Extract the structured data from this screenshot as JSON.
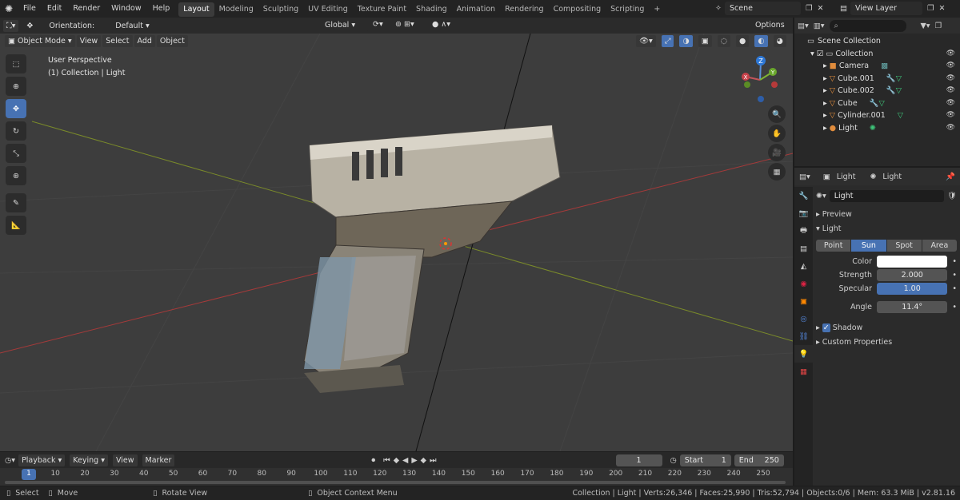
{
  "topbar": {
    "menus": [
      "File",
      "Edit",
      "Render",
      "Window",
      "Help"
    ],
    "workspaces": [
      "Layout",
      "Modeling",
      "Sculpting",
      "UV Editing",
      "Texture Paint",
      "Shading",
      "Animation",
      "Rendering",
      "Compositing",
      "Scripting"
    ],
    "active_workspace": "Layout",
    "add_tab": "+",
    "scene": "Scene",
    "view_layer": "View Layer"
  },
  "viewport_header": {
    "orientation_label": "Orientation:",
    "orientation_value": "Default",
    "transform_orientation": "Global",
    "options": "Options",
    "mode": "Object Mode",
    "menus": [
      "View",
      "Select",
      "Add",
      "Object"
    ]
  },
  "viewport": {
    "perspective": "User Perspective",
    "collection_info": "(1) Collection | Light",
    "gizmo": {
      "x": "X",
      "y": "Y",
      "z": "Z"
    },
    "colors": {
      "background": "#3d3d3d",
      "x_axis": "#b03a3a",
      "y_axis": "#7a8a2a",
      "active_tool": "#4772b3"
    }
  },
  "outliner": {
    "title": "Scene Collection",
    "search_placeholder": "",
    "items": [
      {
        "label": "Collection",
        "icon": "collection-icon"
      },
      {
        "label": "Camera",
        "icon": "camera-icon"
      },
      {
        "label": "Cube.001",
        "icon": "mesh-icon"
      },
      {
        "label": "Cube.002",
        "icon": "mesh-icon"
      },
      {
        "label": "Cube",
        "icon": "mesh-icon"
      },
      {
        "label": "Cylinder.001",
        "icon": "mesh-icon"
      },
      {
        "label": "Light",
        "icon": "light-icon"
      }
    ]
  },
  "properties": {
    "breadcrumb_object": "Light",
    "breadcrumb_data": "Light",
    "datablock_name": "Light",
    "panels": {
      "preview": "Preview",
      "light": "Light",
      "shadow": "Shadow",
      "custom": "Custom Properties"
    },
    "light_types": [
      "Point",
      "Sun",
      "Spot",
      "Area"
    ],
    "active_light_type": "Sun",
    "fields": {
      "color_label": "Color",
      "strength_label": "Strength",
      "strength": "2.000",
      "specular_label": "Specular",
      "specular": "1.00",
      "angle_label": "Angle",
      "angle": "11.4°"
    },
    "shadow_enabled": true
  },
  "timeline": {
    "menus": [
      "Playback",
      "Keying",
      "View",
      "Marker"
    ],
    "current_frame": "1",
    "start_label": "Start",
    "start": "1",
    "end_label": "End",
    "end": "250",
    "ticks": [
      "1",
      "10",
      "20",
      "30",
      "40",
      "50",
      "60",
      "70",
      "80",
      "90",
      "100",
      "110",
      "120",
      "130",
      "140",
      "150",
      "160",
      "170",
      "180",
      "190",
      "200",
      "210",
      "220",
      "230",
      "240",
      "250"
    ]
  },
  "statusbar": {
    "select": "Select",
    "move": "Move",
    "rotate": "Rotate View",
    "context": "Object Context Menu",
    "stats": "Collection | Light | Verts:26,346 | Faces:25,990 | Tris:52,794 | Objects:0/6 | Mem: 63.3 MiB | v2.81.16"
  }
}
